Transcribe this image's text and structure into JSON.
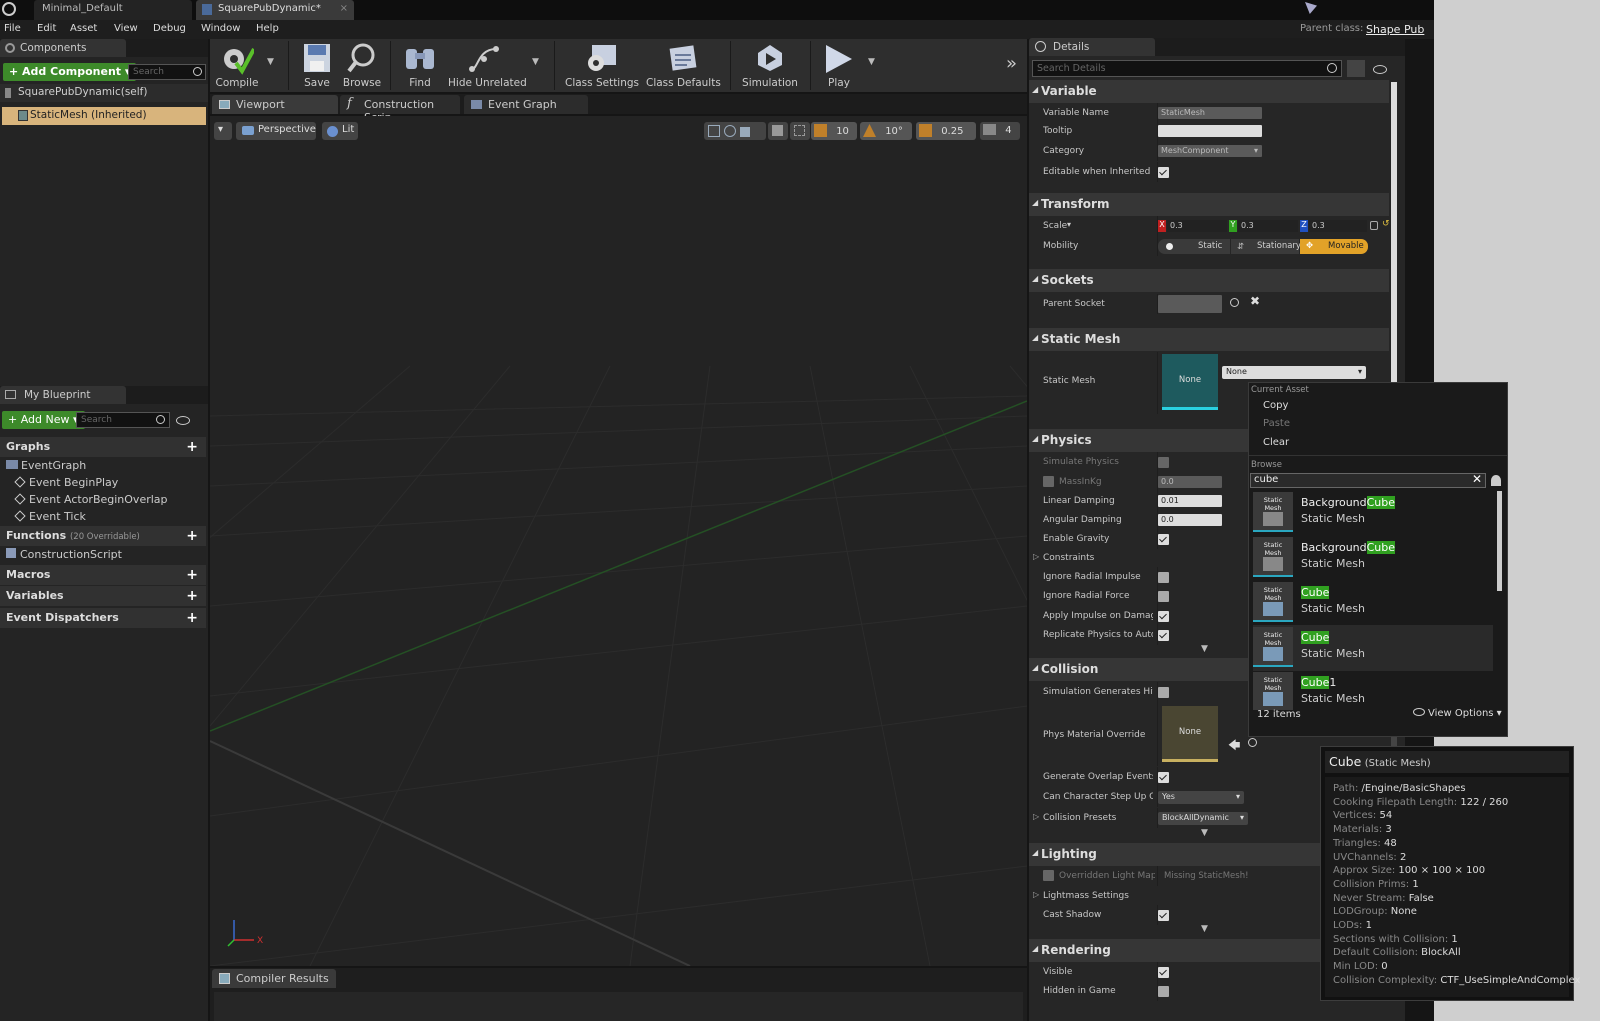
{
  "tabs": [
    {
      "label": "Minimal_Default"
    },
    {
      "label": "SquarePubDynamic*"
    }
  ],
  "parent_class": {
    "label": "Parent class:",
    "value": "Shape Pub"
  },
  "menu": [
    "File",
    "Edit",
    "Asset",
    "View",
    "Debug",
    "Window",
    "Help"
  ],
  "components": {
    "title": "Components",
    "add_label": "Add Component",
    "search_placeholder": "Search",
    "items": [
      "SquarePubDynamic(self)",
      "StaticMesh (Inherited)"
    ]
  },
  "my_blueprint": {
    "title": "My Blueprint",
    "add_label": "Add New",
    "search_placeholder": "Search",
    "graphs_label": "Graphs",
    "event_graph": "EventGraph",
    "events": [
      "Event BeginPlay",
      "Event ActorBeginOverlap",
      "Event Tick"
    ],
    "functions_label": "Functions",
    "functions_note": "(20 Overridable)",
    "construction": "ConstructionScript",
    "macros_label": "Macros",
    "variables_label": "Variables",
    "dispatchers_label": "Event Dispatchers"
  },
  "toolbar": [
    "Compile",
    "Save",
    "Browse",
    "Find",
    "Hide Unrelated",
    "Class Settings",
    "Class Defaults",
    "Simulation",
    "Play"
  ],
  "editor_tabs": [
    "Viewport",
    "Construction Scrip",
    "Event Graph"
  ],
  "viewport": {
    "perspective": "Perspective",
    "lit": "Lit",
    "grid_snap": "10",
    "rot_snap": "10°",
    "scale_snap": "0.25",
    "cam_speed": "4"
  },
  "compiler_tab": "Compiler Results",
  "details": {
    "title": "Details",
    "search_placeholder": "Search Details",
    "variable": {
      "header": "Variable",
      "name_label": "Variable Name",
      "name_value": "StaticMesh",
      "tooltip_label": "Tooltip",
      "category_label": "Category",
      "category_value": "MeshComponent",
      "editable_label": "Editable when Inherited"
    },
    "transform": {
      "header": "Transform",
      "scale_label": "Scale",
      "x": "0.3",
      "y": "0.3",
      "z": "0.3",
      "mobility_label": "Mobility",
      "static": "Static",
      "stationary": "Stationary",
      "movable": "Movable"
    },
    "sockets": {
      "header": "Sockets",
      "parent_label": "Parent Socket"
    },
    "static_mesh": {
      "header": "Static Mesh",
      "label": "Static Mesh",
      "thumb": "None",
      "combo": "None"
    },
    "physics": {
      "header": "Physics",
      "rows": [
        "Simulate Physics",
        "MassInKg",
        "Linear Damping",
        "Angular Damping",
        "Enable Gravity",
        "Constraints",
        "Ignore Radial Impulse",
        "Ignore Radial Force",
        "Apply Impulse on Damage",
        "Replicate Physics to Autonon"
      ],
      "mass": "0.0",
      "linear": "0.01",
      "angular": "0.0"
    },
    "collision": {
      "header": "Collision",
      "rows": [
        "Simulation Generates Hit Eve",
        "Phys Material Override",
        "Generate Overlap Events",
        "Can Character Step Up On",
        "Collision Presets"
      ],
      "phys_thumb": "None",
      "step_value": "Yes",
      "preset_value": "BlockAllDynamic"
    },
    "lighting": {
      "header": "Lighting",
      "rows": [
        "Overridden Light Map Re",
        "Lightmass Settings",
        "Cast Shadow"
      ],
      "missing": "Missing StaticMesh!"
    },
    "rendering": {
      "header": "Rendering",
      "rows": [
        "Visible",
        "Hidden in Game"
      ]
    }
  },
  "picker": {
    "current_asset": "Current Asset",
    "copy": "Copy",
    "paste": "Paste",
    "clear": "Clear",
    "browse": "Browse",
    "search_value": "cube",
    "items": [
      {
        "pre": "Background",
        "hl": "Cube",
        "post": "",
        "type": "Static Mesh"
      },
      {
        "pre": "Background",
        "hl": "Cube",
        "post": "",
        "type": "Static Mesh"
      },
      {
        "pre": "",
        "hl": "Cube",
        "post": "",
        "type": "Static Mesh"
      },
      {
        "pre": "",
        "hl": "Cube",
        "post": "",
        "type": "Static Mesh"
      },
      {
        "pre": "",
        "hl": "Cube",
        "post": "1",
        "type": "Static Mesh"
      }
    ],
    "thumb_label": "Static Mesh",
    "count": "12 items",
    "view_options": "View Options"
  },
  "tooltip": {
    "title": "Cube",
    "subtitle": "(Static Mesh)",
    "lines": [
      {
        "k": "Path:",
        "v": "/Engine/BasicShapes"
      },
      {
        "k": "Cooking Filepath Length:",
        "v": "122 / 260"
      },
      {
        "k": "Vertices:",
        "v": "54"
      },
      {
        "k": "Materials:",
        "v": "3"
      },
      {
        "k": "Triangles:",
        "v": "48"
      },
      {
        "k": "UVChannels:",
        "v": "2"
      },
      {
        "k": "Approx Size:",
        "v": "100 × 100 × 100"
      },
      {
        "k": "Collision Prims:",
        "v": "1"
      },
      {
        "k": "Never Stream:",
        "v": "False"
      },
      {
        "k": "LODGroup:",
        "v": "None"
      },
      {
        "k": "LODs:",
        "v": "1"
      },
      {
        "k": "Sections with Collision:",
        "v": "1"
      },
      {
        "k": "Default Collision:",
        "v": "BlockAll"
      },
      {
        "k": "Min LOD:",
        "v": "0"
      },
      {
        "k": "Collision Complexity:",
        "v": "CTF_UseSimpleAndComplex"
      }
    ]
  }
}
